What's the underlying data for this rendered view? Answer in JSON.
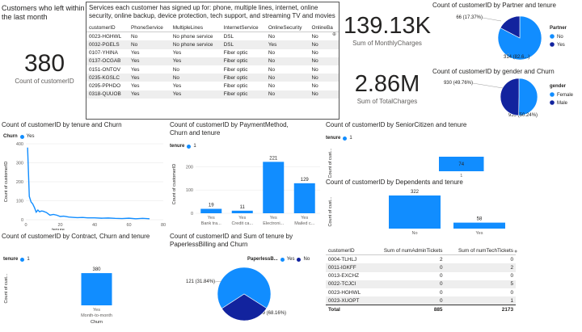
{
  "left_title": "Customers who left within the last month",
  "kpi_count": {
    "value": "380",
    "label": "Count of customerID"
  },
  "services": {
    "title": "Services each customer has signed up for: phone, multiple lines, internet, online security, online backup, device protection, tech support, and streaming TV and movies",
    "columns": [
      "customerID",
      "PhoneService",
      "MultipleLines",
      "InternetService",
      "OnlineSecurity",
      "OnlineBa"
    ],
    "rows": [
      [
        "0023-HGHWL",
        "No",
        "No phone service",
        "DSL",
        "No",
        "No"
      ],
      [
        "0032-PGELS",
        "No",
        "No phone service",
        "DSL",
        "Yes",
        "No"
      ],
      [
        "0107-YHINA",
        "Yes",
        "Yes",
        "Fiber optic",
        "No",
        "No"
      ],
      [
        "0137-OCGAB",
        "Yes",
        "Yes",
        "Fiber optic",
        "No",
        "No"
      ],
      [
        "0151-ONTOV",
        "Yes",
        "No",
        "Fiber optic",
        "No",
        "No"
      ],
      [
        "0235-KGSLC",
        "Yes",
        "No",
        "Fiber optic",
        "No",
        "No"
      ],
      [
        "0295-PPHDO",
        "Yes",
        "Yes",
        "Fiber optic",
        "No",
        "No"
      ],
      [
        "0318-QUUOB",
        "Yes",
        "Yes",
        "Fiber optic",
        "No",
        "No"
      ]
    ]
  },
  "kpi_monthly": {
    "value": "139.13K",
    "label": "Sum of MonthlyCharges"
  },
  "kpi_total": {
    "value": "2.86M",
    "label": "Sum of TotalCharges"
  },
  "colors": {
    "yes": "#118dff",
    "no": "#12239e",
    "primary": "#118dff"
  },
  "axis_tenure": "tenure",
  "axis_churn": "Churn",
  "axis_count": "Count of customerID",
  "axis_count_short": "Count of cust...",
  "legend_one": "1",
  "legend_yes": "Yes",
  "legend_no": "No",
  "chart_data": [
    {
      "type": "pie",
      "title": "Count of customerID by Partner and tenure",
      "legend_title": "Partner",
      "slices": [
        {
          "label": "No",
          "value": 314,
          "text": "314 (82.6...)"
        },
        {
          "label": "Yes",
          "value": 66,
          "text": "66 (17.37%)"
        }
      ]
    },
    {
      "type": "pie",
      "title": "Count of customerID by gender and Churn",
      "legend_title": "gender",
      "slices": [
        {
          "label": "Female",
          "value": 939,
          "text": "939 (50.24%)"
        },
        {
          "label": "Male",
          "value": 930,
          "text": "930 (49.76%)"
        }
      ]
    },
    {
      "type": "line",
      "title": "Count of customerID by tenure and Churn",
      "legend_title": "Churn",
      "series_name": "Yes",
      "xlim": [
        0,
        80
      ],
      "ylim": [
        0,
        400
      ],
      "xticks": [
        0,
        20,
        40,
        60,
        80
      ],
      "yticks": [
        0,
        100,
        200,
        300,
        400
      ],
      "x": [
        1,
        2,
        3,
        4,
        5,
        6,
        7,
        8,
        9,
        10,
        12,
        14,
        16,
        18,
        20,
        22,
        25,
        28,
        30,
        33,
        36,
        40,
        44,
        48,
        52,
        56,
        60,
        64,
        68,
        72
      ],
      "y": [
        380,
        123,
        94,
        83,
        64,
        40,
        51,
        42,
        46,
        45,
        38,
        24,
        28,
        24,
        17,
        19,
        14,
        12,
        11,
        12,
        10,
        10,
        8,
        9,
        7,
        6,
        8,
        5,
        7,
        5
      ]
    },
    {
      "type": "bar",
      "title": "Count of customerID by PaymentMethod, Churn and tenure",
      "legend_title": "tenure",
      "series_name": "1",
      "ylim": [
        0,
        200
      ],
      "yticks": [
        0,
        100,
        200
      ],
      "categories": [
        [
          "Yes",
          "Bank tra..."
        ],
        [
          "Yes",
          "Credit ca..."
        ],
        [
          "Yes",
          "Electroni..."
        ],
        [
          "Yes",
          "Mailed c..."
        ]
      ],
      "values": [
        19,
        11,
        221,
        129
      ]
    },
    {
      "type": "bar",
      "title": "Count of customerID by SeniorCitizen and tenure",
      "legend_title": "tenure",
      "series_name": "1",
      "orientation": "horizontal",
      "categories": [
        "1"
      ],
      "values": [
        74
      ]
    },
    {
      "type": "bar",
      "title": "Count of customerID by Dependents and tenure",
      "categories": [
        "No",
        "Yes"
      ],
      "values": [
        322,
        58
      ]
    },
    {
      "type": "bar",
      "title": "Count of customerID by Contract, Churn and tenure",
      "legend_title": "tenure",
      "series_name": "1",
      "categories": [
        [
          "Yes",
          "Month-to-month"
        ]
      ],
      "values": [
        380
      ],
      "xlabel": "Churn"
    },
    {
      "type": "pie",
      "title": "Count of customerID and Sum of tenure by PaperlessBilling and Churn",
      "legend_title": "PaperlessB...",
      "slices": [
        {
          "label": "Yes",
          "value": 259,
          "text": "259 (68.16%)"
        },
        {
          "label": "No",
          "value": 121,
          "text": "121 (31.84%)"
        }
      ]
    },
    {
      "type": "table",
      "columns": [
        "customerID",
        "Sum of numAdminTickets",
        "Sum of numTechTickets"
      ],
      "rows": [
        [
          "0004-TLHLJ",
          "2",
          "0"
        ],
        [
          "0011-IGKFF",
          "0",
          "2"
        ],
        [
          "0013-EXCHZ",
          "0",
          "0"
        ],
        [
          "0022-TCJCI",
          "0",
          "5"
        ],
        [
          "0023-HGHWL",
          "0",
          "0"
        ],
        [
          "0023-XUOPT",
          "0",
          "1"
        ]
      ],
      "total": [
        "Total",
        "885",
        "2173"
      ]
    }
  ]
}
